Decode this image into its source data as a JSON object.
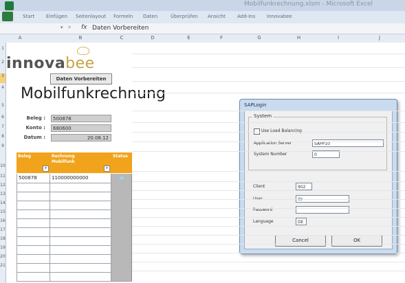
{
  "window": {
    "title": "Mobilfunkrechnung.xlsm - Microsoft Excel"
  },
  "ribbon": {
    "tabs": [
      "Start",
      "Einfügen",
      "Seitenlayout",
      "Formeln",
      "Daten",
      "Überprüfen",
      "Ansicht",
      "Add-Ins",
      "Innovabee"
    ]
  },
  "formula_bar": {
    "fx_label": "fx",
    "content": "Daten Vorbereiten"
  },
  "columns": [
    "A",
    "B",
    "C",
    "D",
    "E",
    "F",
    "G",
    "H",
    "I",
    "J"
  ],
  "rows": [
    "1",
    "2",
    "3",
    "4",
    "5",
    "6",
    "7",
    "8",
    "9",
    "10",
    "11",
    "12",
    "13",
    "14",
    "15",
    "16",
    "17",
    "18",
    "19",
    "20",
    "21"
  ],
  "logo": {
    "part1": "innova",
    "part2": "bee"
  },
  "buttons": {
    "prepare": "Daten Vorbereiten"
  },
  "heading": "Mobilfunkrechnung",
  "info": {
    "beleg_label": "Beleg :",
    "beleg_value": "500878",
    "konto_label": "Konto :",
    "konto_value": "680600",
    "datum_label": "Datum :",
    "datum_value": "20.08.12"
  },
  "table": {
    "headers": {
      "a": "Beleg",
      "b1": "Rechnung",
      "b2": "Mobilfunk",
      "c": "Status"
    },
    "rows": [
      {
        "beleg": "500878",
        "rechnung": "110000000000"
      },
      {
        "beleg": "",
        "rechnung": ""
      },
      {
        "beleg": "",
        "rechnung": ""
      },
      {
        "beleg": "",
        "rechnung": ""
      },
      {
        "beleg": "",
        "rechnung": ""
      },
      {
        "beleg": "",
        "rechnung": ""
      },
      {
        "beleg": "",
        "rechnung": ""
      },
      {
        "beleg": "",
        "rechnung": ""
      },
      {
        "beleg": "",
        "rechnung": ""
      },
      {
        "beleg": "",
        "rechnung": ""
      },
      {
        "beleg": "",
        "rechnung": ""
      },
      {
        "beleg": "",
        "rechnung": ""
      }
    ]
  },
  "dialog": {
    "title": "SAPLogin",
    "group": "System",
    "load_balancing": "Use Load Balancing",
    "app_server_label": "Application Server",
    "app_server_value": "SAPP10",
    "system_number_label": "System Number",
    "system_number_value": "0",
    "client_label": "Client",
    "client_value": "902",
    "user_label": "User",
    "user_value": "ilir",
    "password_label": "Password",
    "password_value": "",
    "language_label": "Language",
    "language_value": "DE",
    "cancel": "Cancel",
    "ok": "OK"
  },
  "colors": {
    "orange": "#f1a31c",
    "excel_green": "#1f7a3a",
    "status_gray": "#b8b8b8"
  }
}
